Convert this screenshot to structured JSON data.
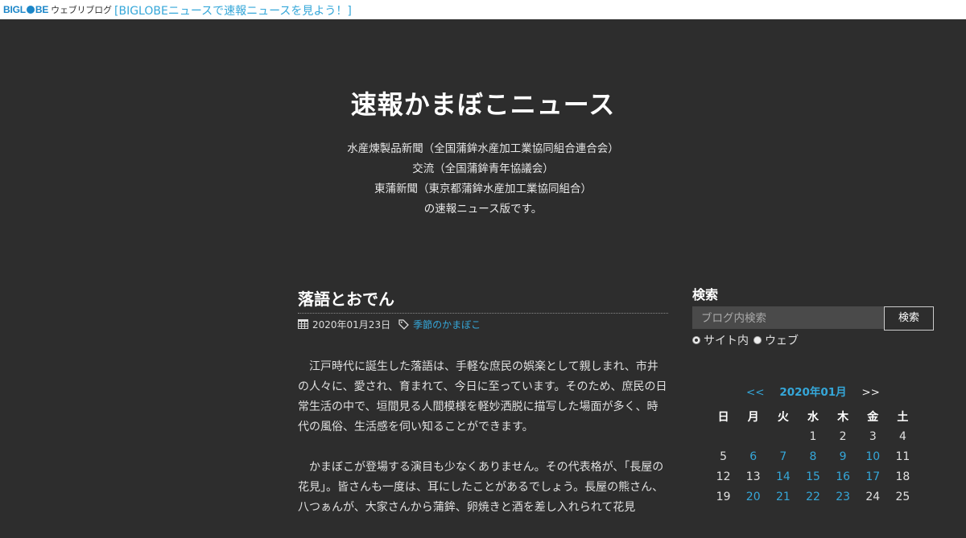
{
  "topbar": {
    "logo_text": "BIGL",
    "logo_text2": "BE",
    "logo_sub": "ウェブリブログ",
    "link_text": "[BIGLOBEニュースで速報ニュースを見よう！]"
  },
  "header": {
    "title": "速報かまぼこニュース",
    "description": [
      "水産煉製品新聞（全国蒲鉾水産加工業協同組合連合会）",
      "交流（全国蒲鉾青年協議会）",
      "東蒲新聞（東京都蒲鉾水産加工業協同組合）",
      "の速報ニュース版です。"
    ]
  },
  "post": {
    "title": "落語とおでん",
    "date": "2020年01月23日",
    "category": "季節のかまぼこ",
    "paragraphs": [
      "江戸時代に誕生した落語は、手軽な庶民の娯楽として親しまれ、市井の人々に、愛され、育まれて、今日に至っています。そのため、庶民の日常生活の中で、垣間見る人間模様を軽妙洒脱に描写した場面が多く、時代の風俗、生活感を伺い知ることができます。",
      "かまぼこが登場する演目も少なくありません。その代表格が、「長屋の花見」。皆さんも一度は、耳にしたことがあるでしょう。長屋の熊さん、八つぁんが、大家さんから蒲鉾、卵焼きと酒を差し入れられて花見"
    ]
  },
  "sidebar": {
    "search_title": "検索",
    "search_placeholder": "ブログ内検索",
    "search_button": "検索",
    "radio_site": "サイト内",
    "radio_web": "ウェブ"
  },
  "calendar": {
    "prev": "<<",
    "month": "2020年01月",
    "next": ">>",
    "weekdays": [
      "日",
      "月",
      "火",
      "水",
      "木",
      "金",
      "土"
    ],
    "weeks": [
      [
        {
          "d": ""
        },
        {
          "d": ""
        },
        {
          "d": ""
        },
        {
          "d": "1"
        },
        {
          "d": "2"
        },
        {
          "d": "3"
        },
        {
          "d": "4"
        }
      ],
      [
        {
          "d": "5"
        },
        {
          "d": "6",
          "link": true
        },
        {
          "d": "7",
          "link": true
        },
        {
          "d": "8",
          "link": true
        },
        {
          "d": "9",
          "link": true
        },
        {
          "d": "10",
          "link": true
        },
        {
          "d": "11"
        }
      ],
      [
        {
          "d": "12"
        },
        {
          "d": "13"
        },
        {
          "d": "14",
          "link": true
        },
        {
          "d": "15",
          "link": true
        },
        {
          "d": "16",
          "link": true
        },
        {
          "d": "17",
          "link": true
        },
        {
          "d": "18"
        }
      ],
      [
        {
          "d": "19"
        },
        {
          "d": "20",
          "link": true
        },
        {
          "d": "21",
          "link": true
        },
        {
          "d": "22",
          "link": true
        },
        {
          "d": "23",
          "link": true
        },
        {
          "d": "24"
        },
        {
          "d": "25"
        }
      ]
    ]
  },
  "colors": {
    "background": "#2d2d2d",
    "link": "#35a7d9",
    "brand": "#1b86c8"
  }
}
